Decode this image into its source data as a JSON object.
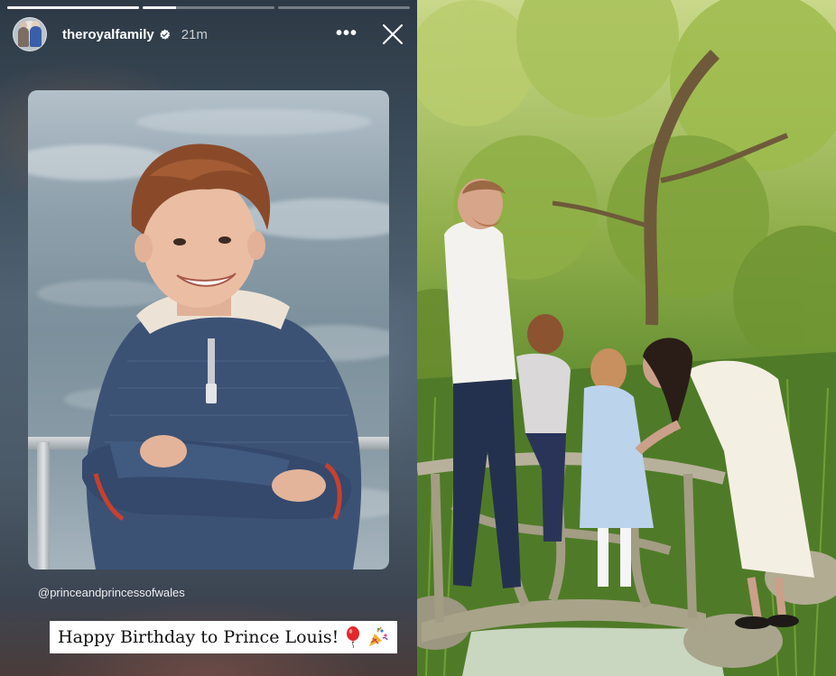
{
  "story": {
    "username": "theroyalfamily",
    "time_ago": "21m",
    "progress": [
      1.0,
      0.25,
      0.0
    ],
    "mention": "@princeandprincessofwales",
    "sticker_text": "Happy Birthday to Prince Louis!",
    "sticker_emojis": [
      "balloon",
      "party-popper"
    ],
    "icons": {
      "verified": "verified-badge-icon",
      "more": "more-options-icon",
      "close": "close-icon"
    }
  }
}
